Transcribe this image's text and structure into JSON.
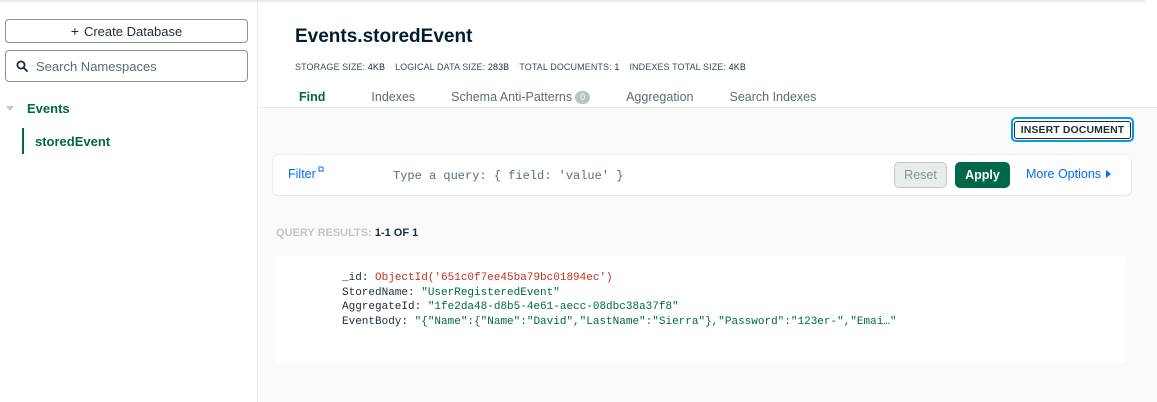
{
  "sidebar": {
    "create_database_label": "Create Database",
    "search_placeholder": "Search Namespaces",
    "database": "Events",
    "collection": "storedEvent"
  },
  "header": {
    "title": "Events.storedEvent",
    "stats": [
      {
        "label": "STORAGE SIZE:",
        "value": "4KB"
      },
      {
        "label": "LOGICAL DATA SIZE:",
        "value": "283B"
      },
      {
        "label": "TOTAL DOCUMENTS:",
        "value": "1"
      },
      {
        "label": "INDEXES TOTAL SIZE:",
        "value": "4KB"
      }
    ],
    "tabs": [
      {
        "label": "Find",
        "active": true
      },
      {
        "label": "Indexes"
      },
      {
        "label": "Schema Anti-Patterns",
        "badge": "0"
      },
      {
        "label": "Aggregation"
      },
      {
        "label": "Search Indexes"
      }
    ]
  },
  "toolbar": {
    "insert_document_label": "INSERT DOCUMENT"
  },
  "filter": {
    "label": "Filter",
    "placeholder": "Type a query: { field: 'value' }",
    "reset_label": "Reset",
    "apply_label": "Apply",
    "more_options_label": "More Options"
  },
  "results": {
    "label": "QUERY RESULTS:",
    "count": "1-1 OF 1"
  },
  "document": {
    "fields": [
      {
        "key": "_id",
        "value": "ObjectId('651c0f7ee45ba79bc01894ec')",
        "type": "oid"
      },
      {
        "key": "StoredName",
        "value": "\"UserRegisteredEvent\"",
        "type": "str"
      },
      {
        "key": "AggregateId",
        "value": "\"1fe2da48-d8b5-4e61-aecc-08dbc38a37f8\"",
        "type": "str"
      },
      {
        "key": "EventBody",
        "value": "\"{\"Name\":{\"Name\":\"David\",\"LastName\":\"Sierra\"},\"Password\":\"123er-\",\"Emai…\"",
        "type": "str"
      }
    ]
  },
  "colors": {
    "brand_green": "#00684a",
    "link_blue": "#016bf8",
    "oid_red": "#c33020",
    "focus_blue": "#0498ec"
  }
}
